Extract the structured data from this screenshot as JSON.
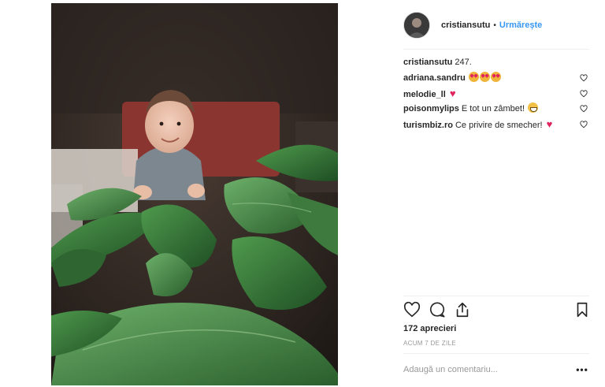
{
  "post": {
    "author": "cristiansutu",
    "separator": "•",
    "follow_label": "Urmărește",
    "comments": [
      {
        "user": "cristiansutu",
        "text": "247."
      },
      {
        "user": "adriana.sandru",
        "text": ""
      },
      {
        "user": "melodie_ll",
        "text": ""
      },
      {
        "user": "poisonmylips",
        "text": "E tot un zâmbet!"
      },
      {
        "user": "turismbiz.ro",
        "text": "Ce privire de smecher!"
      }
    ],
    "likes": "172 aprecieri",
    "time": "ACUM 7 DE ZILE",
    "comment_placeholder": "Adaugă un comentariu...",
    "more_label": "•••"
  },
  "icons": {
    "like": "heart-outline-icon",
    "comment": "speech-bubble-icon",
    "share": "share-upload-icon",
    "save": "bookmark-icon",
    "comment_like": "small-heart-outline-icon"
  },
  "colors": {
    "accent": "#3897f0",
    "heart": "#e0245e",
    "text": "#262626",
    "muted": "#999999"
  }
}
